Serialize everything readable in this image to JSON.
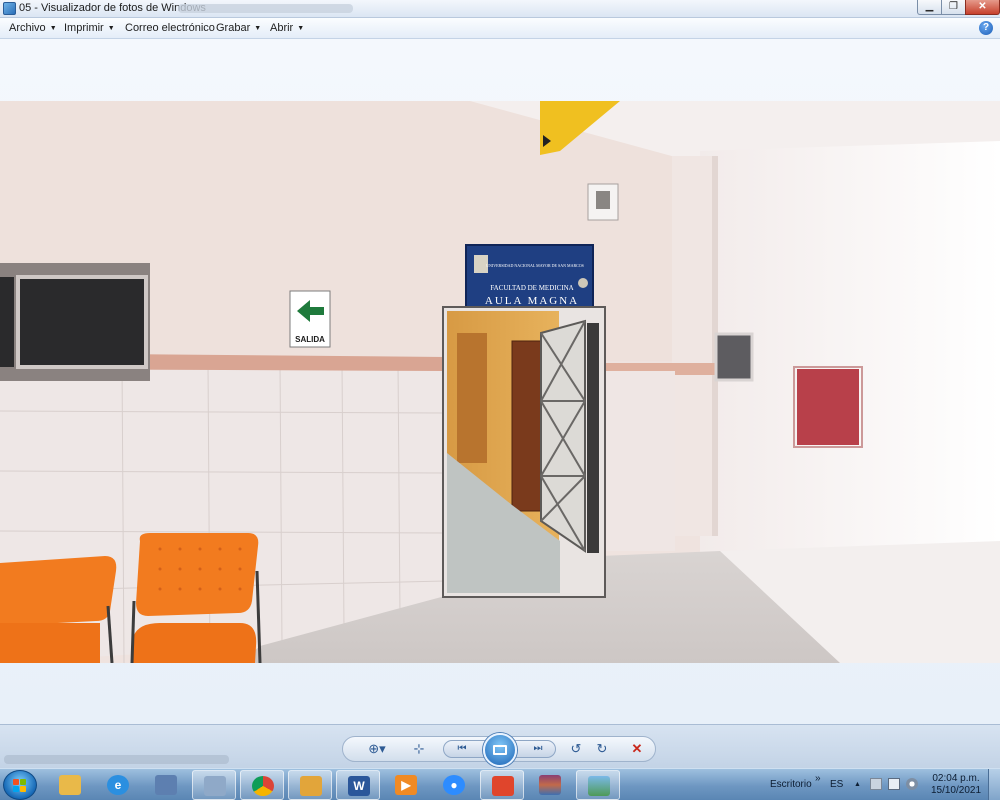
{
  "window": {
    "title": "05 - Visualizador de fotos de Windows",
    "min_glyph": "▁",
    "max_glyph": "❐",
    "close_glyph": "✕"
  },
  "menu": {
    "items": [
      {
        "label": "Archivo"
      },
      {
        "label": "Imprimir"
      },
      {
        "label": "Correo electrónico"
      },
      {
        "label": "Grabar"
      },
      {
        "label": "Abrir"
      }
    ],
    "caret": "▼",
    "help_glyph": "?"
  },
  "photo": {
    "sign_line1": "UNIVERSIDAD NACIONAL MAYOR DE SAN MARCOS",
    "sign_line2": "FACULTAD DE MEDICINA",
    "sign_line3": "AULA MAGNA",
    "exit_sign": "SALIDA",
    "colors": {
      "wall": "#efe2dd",
      "tile": "#eee6e5",
      "stripe": "#d9a18c",
      "chair": "#f07a1e",
      "sign_blue": "#1f3f82",
      "floor": "#d8d2cf"
    }
  },
  "controls": {
    "zoom_glyph": "⊕▾",
    "fit_glyph": "⊹",
    "prev_glyph": "⏮",
    "next_glyph": "⏭",
    "rotate_left_glyph": "↺",
    "rotate_right_glyph": "↻",
    "delete_glyph": "✕"
  },
  "taskbar": {
    "apps": [
      {
        "icon": "folder-icon",
        "glyph": "",
        "color": "#e9b949"
      },
      {
        "icon": "ie-icon",
        "glyph": "e",
        "color": "#2b8fe0"
      },
      {
        "icon": "network-icon",
        "glyph": "",
        "color": "#5d7fb0"
      },
      {
        "icon": "windows-icon",
        "glyph": "",
        "color": "#8fa9c8"
      },
      {
        "icon": "chrome-icon",
        "glyph": "",
        "color": "#db4437"
      },
      {
        "icon": "outlook-icon",
        "glyph": "",
        "color": "#e2a53a"
      },
      {
        "icon": "word-icon",
        "glyph": "W",
        "color": "#2b579a"
      },
      {
        "icon": "media-player-icon",
        "glyph": "▶",
        "color": "#f08a24"
      },
      {
        "icon": "zoom-icon",
        "glyph": "●",
        "color": "#2d8cff"
      },
      {
        "icon": "pdf-icon",
        "glyph": "",
        "color": "#e0452c"
      },
      {
        "icon": "winrar-icon",
        "glyph": "",
        "color": "#8a3f73"
      },
      {
        "icon": "photo-viewer-icon",
        "glyph": "",
        "color": "#4e9a57"
      }
    ],
    "desktop_label": "Escritorio",
    "chevron": "»",
    "language": "ES",
    "tray_arrow": "▲",
    "time": "02:04 p.m.",
    "date": "15/10/2021"
  }
}
